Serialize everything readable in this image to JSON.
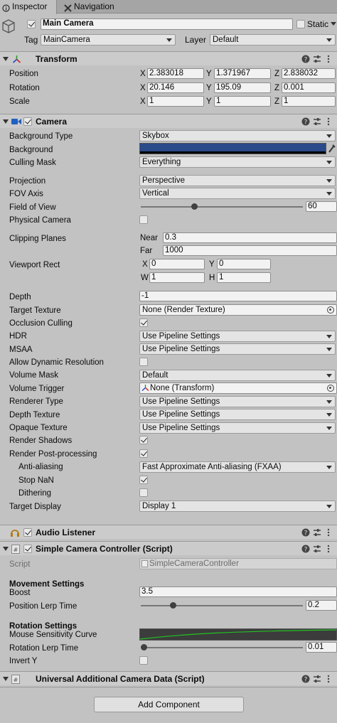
{
  "tabs": {
    "inspector": "Inspector",
    "navigation": "Navigation"
  },
  "object": {
    "name": "Main Camera",
    "static_label": "Static",
    "tag_label": "Tag",
    "tag_value": "MainCamera",
    "layer_label": "Layer",
    "layer_value": "Default"
  },
  "transform": {
    "title": "Transform",
    "position_label": "Position",
    "rotation_label": "Rotation",
    "scale_label": "Scale",
    "axis_x": "X",
    "axis_y": "Y",
    "axis_z": "Z",
    "position": {
      "x": "2.383018",
      "y": "1.371967",
      "z": "2.838032"
    },
    "rotation": {
      "x": "20.146",
      "y": "195.09",
      "z": "0.001"
    },
    "scale": {
      "x": "1",
      "y": "1",
      "z": "1"
    }
  },
  "camera": {
    "title": "Camera",
    "background_type_label": "Background Type",
    "background_type": "Skybox",
    "background_label": "Background",
    "background_color": "#2a4a8a",
    "culling_mask_label": "Culling Mask",
    "culling_mask": "Everything",
    "projection_label": "Projection",
    "projection": "Perspective",
    "fov_axis_label": "FOV Axis",
    "fov_axis": "Vertical",
    "fov_label": "Field of View",
    "fov": "60",
    "fov_fraction": 0.46,
    "physical_camera_label": "Physical Camera",
    "clipping_label": "Clipping Planes",
    "near_label": "Near",
    "near": "0.3",
    "far_label": "Far",
    "far": "1000",
    "viewport_label": "Viewport Rect",
    "vp_x_label": "X",
    "vp_x": "0",
    "vp_y_label": "Y",
    "vp_y": "0",
    "vp_w_label": "W",
    "vp_w": "1",
    "vp_h_label": "H",
    "vp_h": "1",
    "depth_label": "Depth",
    "depth": "-1",
    "target_texture_label": "Target Texture",
    "target_texture": "None (Render Texture)",
    "occlusion_label": "Occlusion Culling",
    "hdr_label": "HDR",
    "hdr": "Use Pipeline Settings",
    "msaa_label": "MSAA",
    "msaa": "Use Pipeline Settings",
    "dyn_res_label": "Allow Dynamic Resolution",
    "volume_mask_label": "Volume Mask",
    "volume_mask": "Default",
    "volume_trigger_label": "Volume Trigger",
    "volume_trigger": "None (Transform)",
    "renderer_type_label": "Renderer Type",
    "renderer_type": "Use Pipeline Settings",
    "depth_texture_label": "Depth Texture",
    "depth_texture": "Use Pipeline Settings",
    "opaque_texture_label": "Opaque Texture",
    "opaque_texture": "Use Pipeline Settings",
    "render_shadows_label": "Render Shadows",
    "render_post_label": "Render Post-processing",
    "anti_aliasing_label": "Anti-aliasing",
    "anti_aliasing": "Fast Approximate Anti-aliasing (FXAA)",
    "stop_nan_label": "Stop NaN",
    "dithering_label": "Dithering",
    "target_display_label": "Target Display",
    "target_display": "Display 1"
  },
  "audio": {
    "title": "Audio Listener"
  },
  "controller": {
    "title": "Simple Camera Controller (Script)",
    "script_label": "Script",
    "script": "SimpleCameraController",
    "movement_header": "Movement Settings",
    "boost_label": "Boost",
    "boost": "3.5",
    "pos_lerp_label": "Position Lerp Time",
    "pos_lerp": "0.2",
    "pos_lerp_fraction": 0.2,
    "rotation_header": "Rotation Settings",
    "mouse_curve_label": "Mouse Sensitivity Curve",
    "rot_lerp_label": "Rotation Lerp Time",
    "rot_lerp": "0.01",
    "rot_lerp_fraction": 0.01,
    "invert_y_label": "Invert Y"
  },
  "urp": {
    "title": "Universal Additional Camera Data (Script)"
  },
  "add_component": "Add Component"
}
